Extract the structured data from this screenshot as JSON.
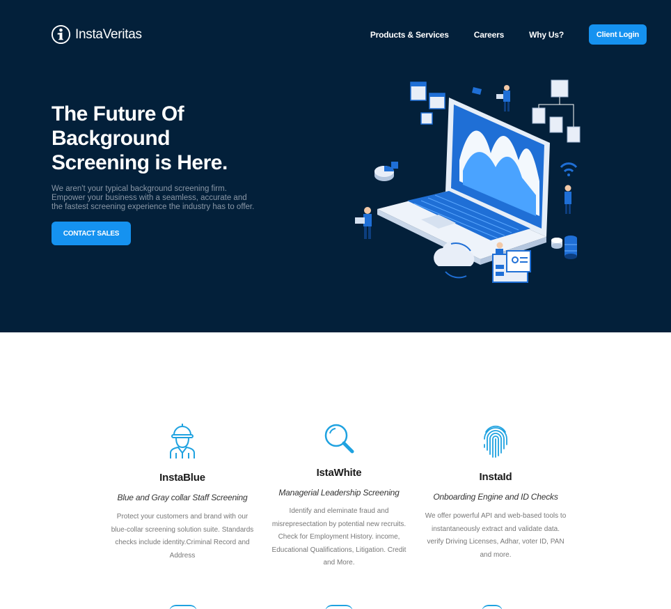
{
  "brand": {
    "name": "InstaVeritas"
  },
  "nav": {
    "items": [
      {
        "label": "Products & Services"
      },
      {
        "label": "Careers"
      },
      {
        "label": "Why Us?"
      }
    ],
    "login_label": "Client Login"
  },
  "hero": {
    "title": "The Future Of Background Screening is Here.",
    "title_lines": [
      "The Future Of",
      "Background",
      "Screening is Here."
    ],
    "description_lines": [
      "We aren't your typical background screening firm.",
      "Empower your business with a seamless, accurate and",
      "the fastest screening experience the industry has to offer."
    ],
    "cta_label": "CONTACT SALES"
  },
  "features": [
    {
      "icon": "worker-helmet-icon",
      "title": "InstaBlue",
      "subtitle": "Blue and Gray collar Staff Screening",
      "description_lines": [
        "Protect your customers and brand with our",
        "blue-collar screening solution suite. Standards",
        "checks include identity.Criminal Record and",
        "Address"
      ]
    },
    {
      "icon": "magnifier-icon",
      "title": "IstaWhite",
      "subtitle": "Managerial Leadership Screening",
      "description_lines": [
        "Identify and eleminate fraud and",
        "misrepresectation by potential new recruits.",
        "Check for Employment History. income,",
        "Educational Qualifications, Litigation. Credit",
        "and More."
      ]
    },
    {
      "icon": "fingerprint-icon",
      "title": "InstaId",
      "subtitle": "Onboarding Engine and ID Checks",
      "description_lines": [
        "We offer powerful API and web-based tools to",
        "instantaneously extract and validate data.",
        "verify Driving Licenses, Adhar, voter ID, PAN",
        "and more."
      ]
    }
  ],
  "colors": {
    "hero_bg": "#03203a",
    "accent": "#1592f0",
    "icon_blue": "#1fa2e0"
  }
}
